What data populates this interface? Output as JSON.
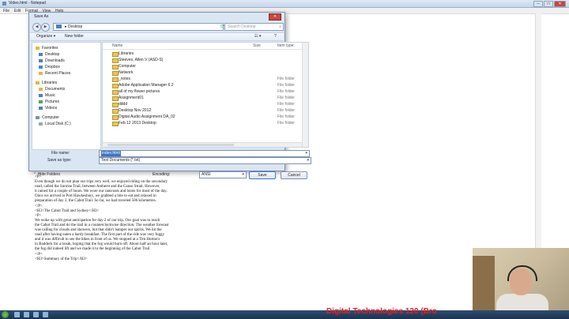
{
  "notepad": {
    "title": "Video.html - Notepad",
    "menu": [
      "File",
      "Edit",
      "Format",
      "View",
      "Help"
    ],
    "controls": {
      "min": "–",
      "max": "□",
      "close": "✕"
    },
    "text_lines": [
      "<P>",
      "Even though we do not plan our trips very well, we enjoyed riding on the secondary",
      "road, called the Sunrise Trail, between Amherst and the Canso Strait. However,",
      "it rained for a couple of hours. We wore our raincoats and boots for most of the day.",
      "Once we arrived in Port Hawkesbury, we grabbed a bite to eat and relaxed in",
      "preparation of day 2, the Cabot Trail. So far, we had traveled 506 kilometres.",
      "</P>",
      "",
      "<H3>The Cabot Trail and Sydney</H3>",
      "",
      "<P>",
      "We woke up with great anticipation for day 2 of our trip. Our goal was to reach",
      "the Cabot Trail and do the trail in a counterclockwise direction. The weather forecast",
      "was calling for clouds and showers, but that didn't hamper our spirits. We hit the",
      "road after having eaten a hardy breakfast. The first part of the ride was very foggy",
      "and it was difficult to see the bikes in front of us. We stopped at a Tim Horton's",
      "in Baddeck for a break, hoping that the fog would burn off. About half an hour later,",
      "the fog did indeed lift and we made it to the beginning of the Cabot Trail",
      "</P>",
      "",
      "<H3>Summary of the Trip</H3>"
    ]
  },
  "dialog": {
    "title": "Save As",
    "close": "✕",
    "address": "Desktop",
    "address_arrow": "▸",
    "search_placeholder": "Search Desktop",
    "toolbar": {
      "organize": "Organize ▾",
      "new_folder": "New folder",
      "help": "?",
      "view": "☷ ▾"
    },
    "nav": [
      {
        "label": "Favorites",
        "top": true,
        "color": "#e5b73b"
      },
      {
        "label": "Desktop",
        "top": false,
        "color": "#4f7fc2"
      },
      {
        "label": "Downloads",
        "top": false,
        "color": "#4f7fc2"
      },
      {
        "label": "Dropbox",
        "top": false,
        "color": "#3d8ad6"
      },
      {
        "label": "Recent Places",
        "top": false,
        "color": "#e5b73b"
      },
      {
        "gap": true
      },
      {
        "label": "Libraries",
        "top": true,
        "color": "#e5b73b"
      },
      {
        "label": "Documents",
        "top": false,
        "color": "#e5b73b"
      },
      {
        "label": "Music",
        "top": false,
        "color": "#4f7fc2"
      },
      {
        "label": "Pictures",
        "top": false,
        "color": "#5aa35a"
      },
      {
        "label": "Videos",
        "top": false,
        "color": "#4f7fc2"
      },
      {
        "gap": true
      },
      {
        "label": "Computer",
        "top": true,
        "color": "#7c8fa8"
      },
      {
        "label": "Local Disk (C:)",
        "top": false,
        "color": "#9aa6b5"
      }
    ],
    "columns": {
      "name": "Name",
      "size": "Size",
      "type": "Item type"
    },
    "files": [
      {
        "name": "Libraries",
        "type": ""
      },
      {
        "name": "Steeves, Allen V (ASD-S)",
        "type": ""
      },
      {
        "name": "Computer",
        "type": ""
      },
      {
        "name": "Network",
        "type": ""
      },
      {
        "name": "_notes",
        "type": "File folder"
      },
      {
        "name": "Adobe Application Manager 6.2",
        "type": "File folder"
      },
      {
        "name": "all of my flower pictures",
        "type": "File folder"
      },
      {
        "name": "Assignment01",
        "type": "File folder"
      },
      {
        "name": "dddd",
        "type": "File folder"
      },
      {
        "name": "Desktop Nov 2012",
        "type": "File folder"
      },
      {
        "name": "Digital Audio Assignment DA_02",
        "type": "File folder"
      },
      {
        "name": "Feb 12 2013 Desktop",
        "type": "File folder"
      }
    ],
    "file_name_label": "File name:",
    "file_name_value": "index.html",
    "save_type_label": "Save as type:",
    "save_type_value": "Text Documents (*.txt)",
    "hide_folders": "Hide Folders",
    "encoding_label": "Encoding:",
    "encoding_value": "ANSI",
    "save_button": "Save",
    "cancel_button": "Cancel"
  },
  "overlay": {
    "brand_text": "Digital Technologies 120 (Bro"
  }
}
